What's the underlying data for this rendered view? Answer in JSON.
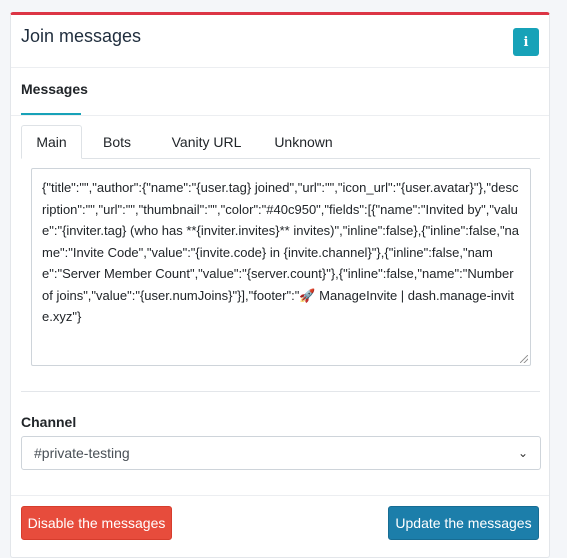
{
  "card": {
    "title": "Join messages",
    "info_button": "i"
  },
  "section": {
    "label": "Messages"
  },
  "tabs": [
    {
      "label": "Main",
      "active": true
    },
    {
      "label": "Bots",
      "active": false
    },
    {
      "label": "Vanity URL",
      "active": false
    },
    {
      "label": "Unknown",
      "active": false
    }
  ],
  "editor": {
    "value": "{\"title\":\"\",\"author\":{\"name\":\"{user.tag} joined\",\"url\":\"\",\"icon_url\":\"{user.avatar}\"},\"description\":\"\",\"url\":\"\",\"thumbnail\":\"\",\"color\":\"#40c950\",\"fields\":[{\"name\":\"Invited by\",\"value\":\"{inviter.tag} (who has **{inviter.invites}** invites)\",\"inline\":false},{\"inline\":false,\"name\":\"Invite Code\",\"value\":\"{invite.code} in {invite.channel}\"},{\"inline\":false,\"name\":\"Server Member Count\",\"value\":\"{server.count}\"},{\"inline\":false,\"name\":\"Number of joins\",\"value\":\"{user.numJoins}\"}],\"footer\":\"🚀 ManageInvite | dash.manage-invite.xyz\"}"
  },
  "channel": {
    "label": "Channel",
    "selected": "#private-testing"
  },
  "buttons": {
    "disable": "Disable the messages",
    "update": "Update the messages"
  },
  "colors": {
    "header_accent": "#dc3545",
    "info": "#17a2b8",
    "danger": "#e74c3c",
    "primary": "#1c7eaa"
  }
}
